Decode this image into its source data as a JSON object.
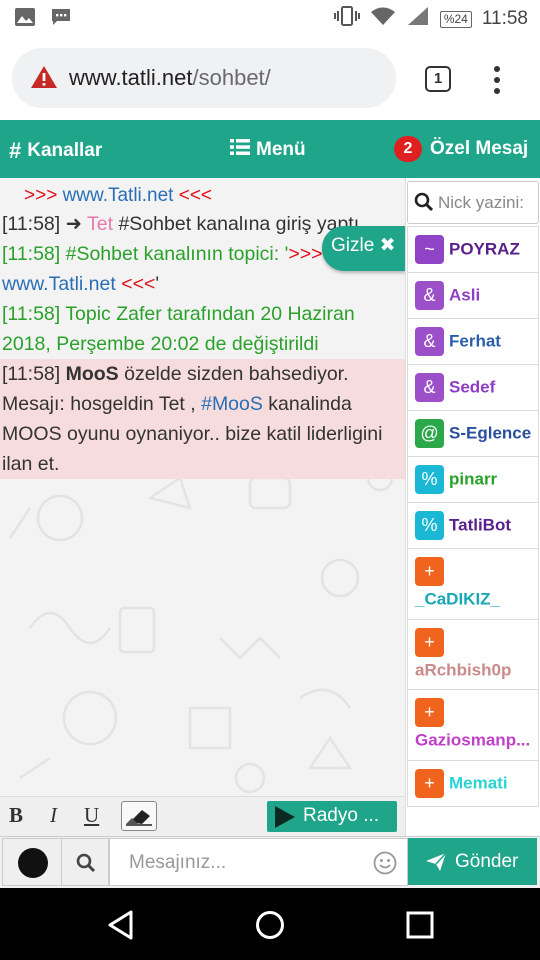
{
  "status_bar": {
    "battery": "%24",
    "time": "11:58",
    "icons": [
      "image-icon",
      "message-icon",
      "vibrate-icon",
      "wifi-icon",
      "signal-icon",
      "battery-icon"
    ]
  },
  "browser": {
    "url_host": "www.tatli.net",
    "url_path": "/sohbet/",
    "tab_count": "1",
    "icons": [
      "warning-icon",
      "tab-switcher-icon",
      "kebab-menu-icon"
    ]
  },
  "nav": {
    "channels": "Kanallar",
    "menu": "Menü",
    "pm_badge": "2",
    "pm": "Özel Mesaj"
  },
  "chat": {
    "top_line": {
      "prefix": ">>> ",
      "site": "www.Tatli.net",
      "suffix": " <<<"
    },
    "join": {
      "time": "[11:58]",
      "nick": "Tet",
      "text": " #Sohbet kanalına giriş yaptı"
    },
    "topic": {
      "time": "[11:58]",
      "text": " #Sohbet kanalının topici: '",
      "arrows": ">>>",
      "site": "www.Tatli.net",
      "arrows_end": " <<<",
      "end": "'"
    },
    "topic_change": {
      "time": "[11:58]",
      "text": " Topic Zafer tarafından 20 Haziran 2018, Perşembe 20:02 de değiştirildi"
    },
    "mention": {
      "time": "[11:58]",
      "nick": "MooS",
      "text1": " özelde sizden bahsediyor. Mesajı: hosgeldin Tet , ",
      "channel": "#MooS",
      "text2": " kanalinda MOOS oyunu oynaniyor.. bize katil liderligini ilan et."
    },
    "hide_button": "Gizle"
  },
  "toolbar": {
    "bold": "B",
    "italic": "I",
    "underline": "U",
    "radio": "Radyo ..."
  },
  "nick_search": {
    "placeholder": "Nick yazini:"
  },
  "nicks": [
    {
      "symbol": "~",
      "name": "POYRAZ",
      "icon_color": "#8e44c4",
      "name_color": "#5a1f8a"
    },
    {
      "symbol": "&",
      "name": "Asli",
      "icon_color": "#9b4fc9",
      "name_color": "#8e3ec4"
    },
    {
      "symbol": "&",
      "name": "Ferhat",
      "icon_color": "#9b4fc9",
      "name_color": "#2a5ea8"
    },
    {
      "symbol": "&",
      "name": "Sedef",
      "icon_color": "#9b4fc9",
      "name_color": "#8e3ec4"
    },
    {
      "symbol": "@",
      "name": "S-Eglence",
      "icon_color": "#2aa84a",
      "name_color": "#2a4fa0"
    },
    {
      "symbol": "%",
      "name": "pinarr",
      "icon_color": "#1bb8d6",
      "name_color": "#2aa12a"
    },
    {
      "symbol": "%",
      "name": "TatliBot",
      "icon_color": "#1bb8d6",
      "name_color": "#5a1f8a"
    },
    {
      "symbol": "+",
      "name": "_CaDIKIZ_",
      "icon_color": "#f0641e",
      "name_color": "#1aa8b8"
    },
    {
      "symbol": "+",
      "name": "aRchbish0p",
      "icon_color": "#f0641e",
      "name_color": "#c98a8a"
    },
    {
      "symbol": "+",
      "name": "Gaziosmanp...",
      "icon_color": "#f0641e",
      "name_color": "#c040c8"
    },
    {
      "symbol": "+",
      "name": "Memati",
      "icon_color": "#f0641e",
      "name_color": "#2ad4d4"
    }
  ],
  "input": {
    "placeholder": "Mesajınız...",
    "send": "Gönder"
  },
  "colors": {
    "accent": "#1fa58a",
    "highlight": "#f6dcdc",
    "badge": "#e02020"
  }
}
